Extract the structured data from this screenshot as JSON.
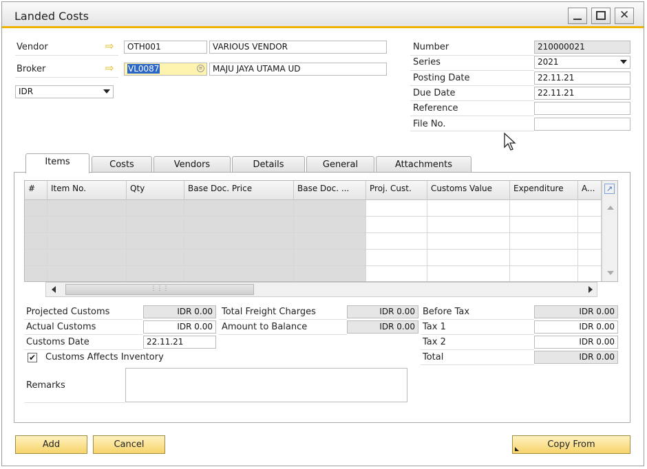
{
  "window": {
    "title": "Landed Costs"
  },
  "header": {
    "vendor_label": "Vendor",
    "vendor_code": "OTH001",
    "vendor_name": "VARIOUS VENDOR",
    "broker_label": "Broker",
    "broker_code": "VL0087",
    "broker_name": "MAJU JAYA UTAMA UD",
    "currency": "IDR"
  },
  "doc": {
    "number_label": "Number",
    "number_value": "210000021",
    "series_label": "Series",
    "series_value": "2021",
    "posting_label": "Posting Date",
    "posting_value": "22.11.21",
    "due_label": "Due Date",
    "due_value": "22.11.21",
    "reference_label": "Reference",
    "reference_value": "",
    "fileno_label": "File No.",
    "fileno_value": ""
  },
  "tabs": [
    "Items",
    "Costs",
    "Vendors",
    "Details",
    "General",
    "Attachments"
  ],
  "grid": {
    "columns": [
      "#",
      "Item No.",
      "Qty",
      "Base Doc. Price",
      "Base Doc. ...",
      "Proj. Cust.",
      "Customs Value",
      "Expenditure",
      "A..."
    ]
  },
  "totals": {
    "projected_customs_label": "Projected Customs",
    "projected_customs_value": "IDR 0.00",
    "actual_customs_label": "Actual Customs",
    "actual_customs_value": "IDR 0.00",
    "customs_date_label": "Customs Date",
    "customs_date_value": "22.11.21",
    "affects_inventory_label": "Customs Affects Inventory",
    "affects_inventory_checked": "✔",
    "freight_label": "Total Freight Charges",
    "freight_value": "IDR 0.00",
    "balance_label": "Amount to Balance",
    "balance_value": "IDR 0.00",
    "before_tax_label": "Before Tax",
    "before_tax_value": "IDR 0.00",
    "tax1_label": "Tax 1",
    "tax1_value": "IDR 0.00",
    "tax2_label": "Tax 2",
    "tax2_value": "IDR 0.00",
    "total_label": "Total",
    "total_value": "IDR 0.00",
    "remarks_label": "Remarks",
    "remarks_value": ""
  },
  "buttons": {
    "add": "Add",
    "cancel": "Cancel",
    "copy_from": "Copy From"
  },
  "colors": {
    "accent": "#f0b400",
    "button": "#f7d36a"
  }
}
